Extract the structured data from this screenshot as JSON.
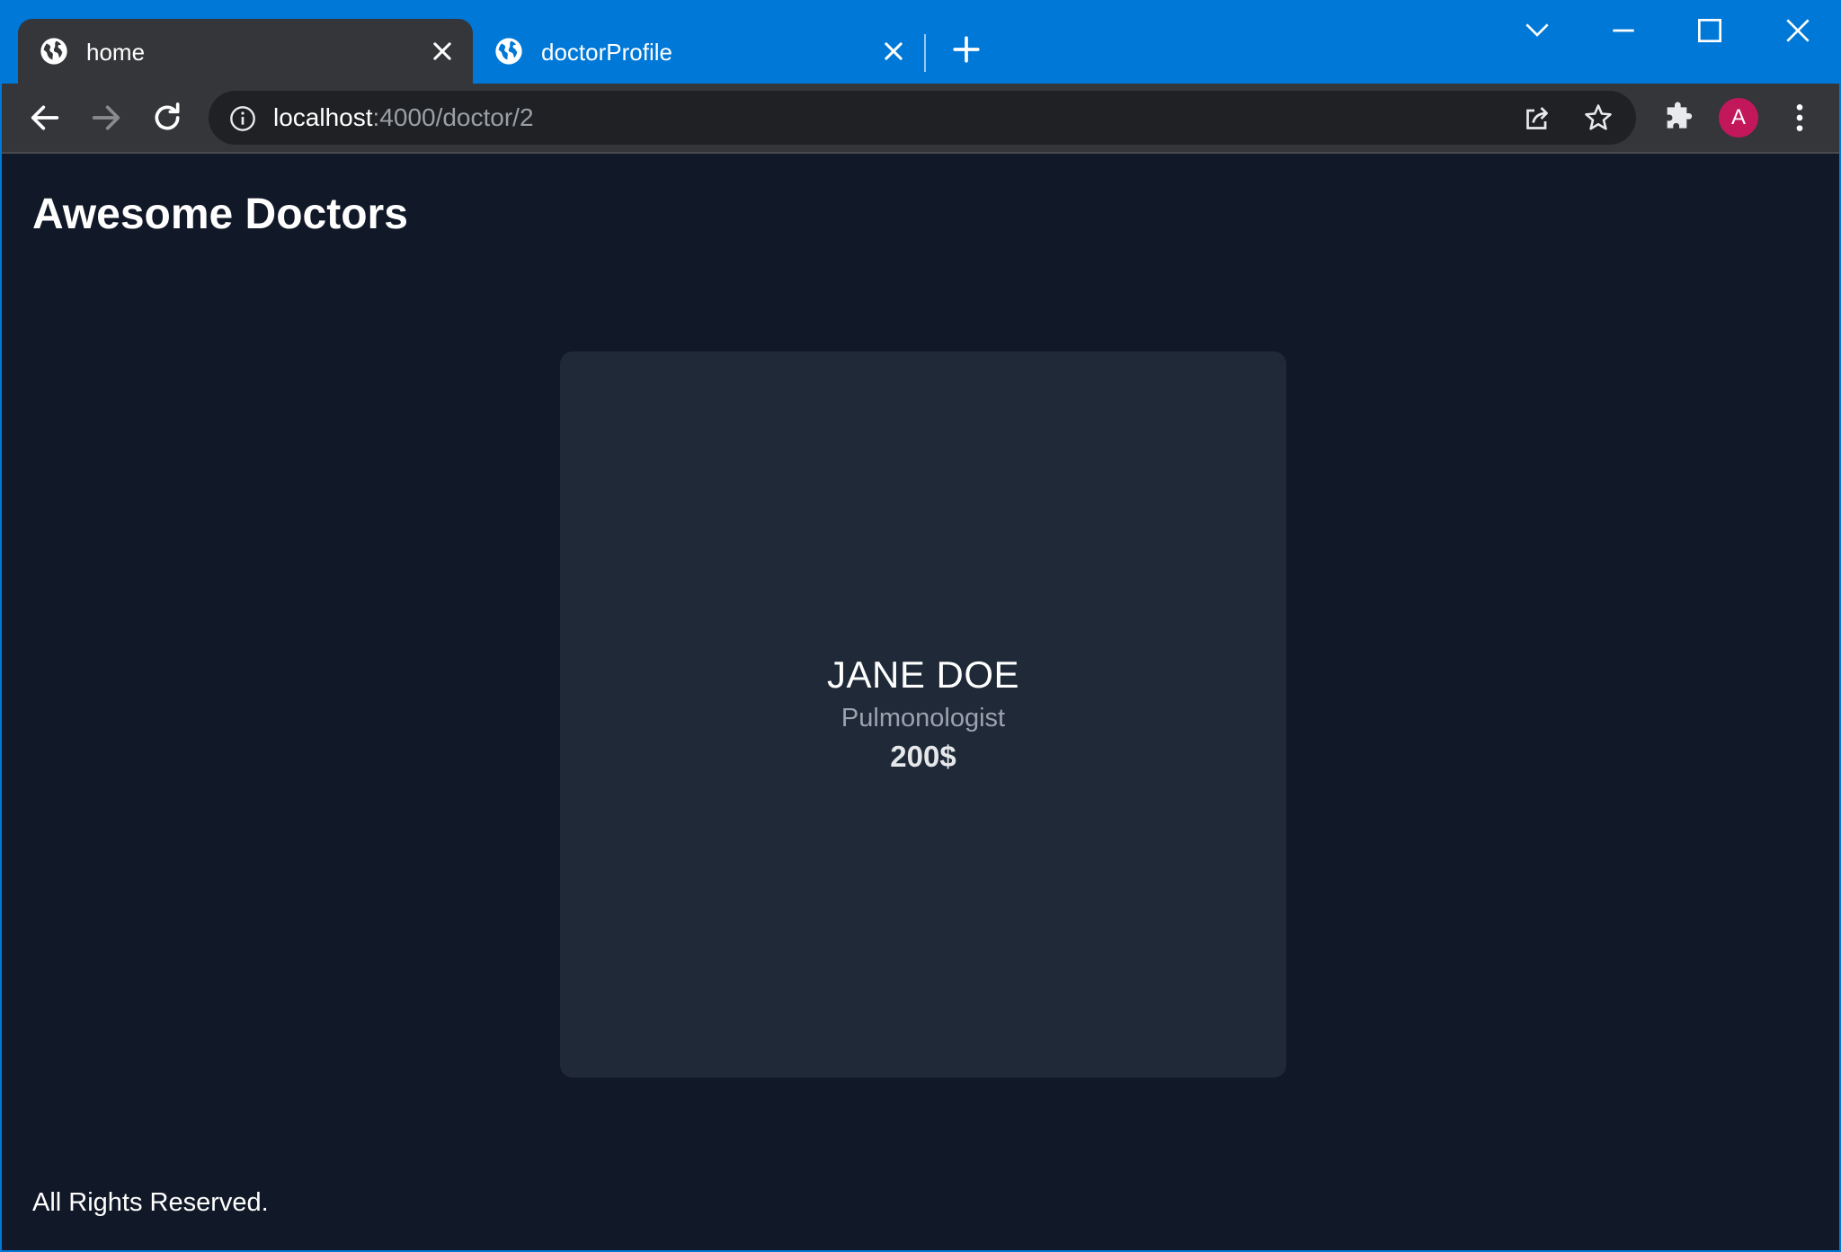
{
  "browser": {
    "tabs": [
      {
        "title": "home",
        "active": true
      },
      {
        "title": "doctorProfile",
        "active": false
      }
    ],
    "address": {
      "host": "localhost",
      "rest": ":4000/doctor/2"
    },
    "profile_initial": "A",
    "accent_color": "#0078d7",
    "avatar_color": "#c2185b"
  },
  "page": {
    "site_title": "Awesome Doctors",
    "doctor": {
      "name": "JANE DOE",
      "specialty": "Pulmonologist",
      "price": "200$"
    },
    "footer": "All Rights Reserved."
  }
}
